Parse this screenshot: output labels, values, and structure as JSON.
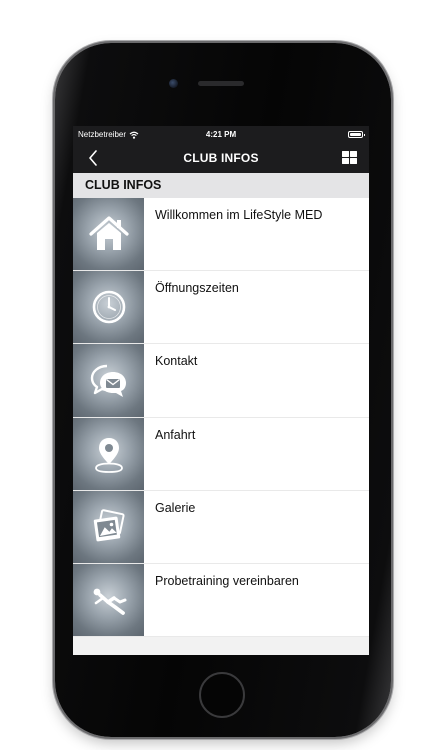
{
  "status_bar": {
    "carrier": "Netzbetreiber",
    "time": "4:21 PM"
  },
  "nav": {
    "title": "CLUB INFOS",
    "back_icon": "chevron-left-icon",
    "menu_icon": "grid-icon"
  },
  "section": {
    "title": "CLUB INFOS"
  },
  "items": [
    {
      "label": "Willkommen im LifeStyle MED",
      "icon": "home-icon"
    },
    {
      "label": "Öffnungszeiten",
      "icon": "clock-icon"
    },
    {
      "label": "Kontakt",
      "icon": "chat-mail-icon"
    },
    {
      "label": "Anfahrt",
      "icon": "map-pin-icon"
    },
    {
      "label": "Galerie",
      "icon": "photo-gallery-icon"
    },
    {
      "label": "Probetraining vereinbaren",
      "icon": "workout-icon"
    }
  ],
  "colors": {
    "bar_background": "#1c1c1e",
    "section_background": "#e4e4e6",
    "tile_gradient_center": "#c9d0d6",
    "tile_gradient_edge": "#5d666f"
  }
}
